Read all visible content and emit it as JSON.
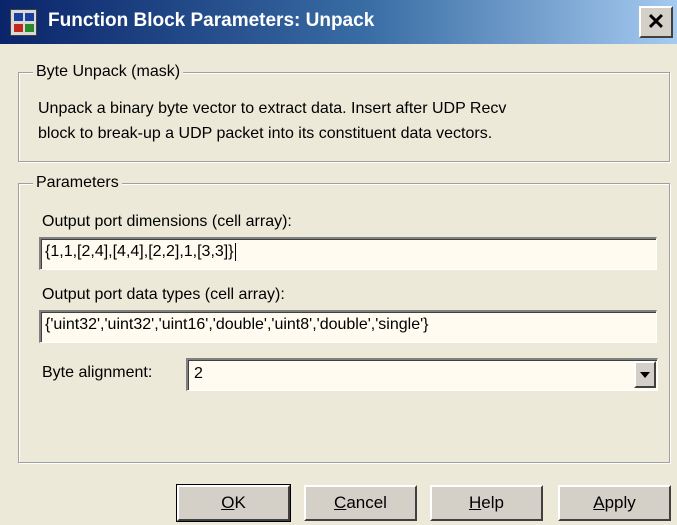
{
  "window": {
    "title": "Function Block Parameters: Unpack",
    "close_glyph": "✕"
  },
  "mask_group": {
    "legend": "Byte Unpack (mask)",
    "description_line1": "Unpack a binary byte vector to extract data. Insert after UDP Recv",
    "description_line2": "block to break-up a UDP packet into its constituent data vectors."
  },
  "params_group": {
    "legend": "Parameters",
    "dims_label": "Output port dimensions (cell array):",
    "dims_value": "{1,1,[2,4],[4,4],[2,2],1,[3,3]}",
    "types_label": "Output port data types (cell array):",
    "types_value": "{'uint32','uint32','uint16','double','uint8','double','single'}",
    "align_label": "Byte alignment:",
    "align_value": "2"
  },
  "buttons": {
    "ok": {
      "accel": "O",
      "rest": "K"
    },
    "cancel": {
      "accel": "C",
      "rest": "ancel"
    },
    "help": {
      "accel": "H",
      "rest": "elp"
    },
    "apply": {
      "accel": "A",
      "rest": "pply"
    }
  },
  "colors": {
    "titlebar_start": "#0a246a",
    "titlebar_end": "#a6caf0",
    "dialog_bg": "#ece9d8",
    "field_bg": "#fffbf0"
  }
}
